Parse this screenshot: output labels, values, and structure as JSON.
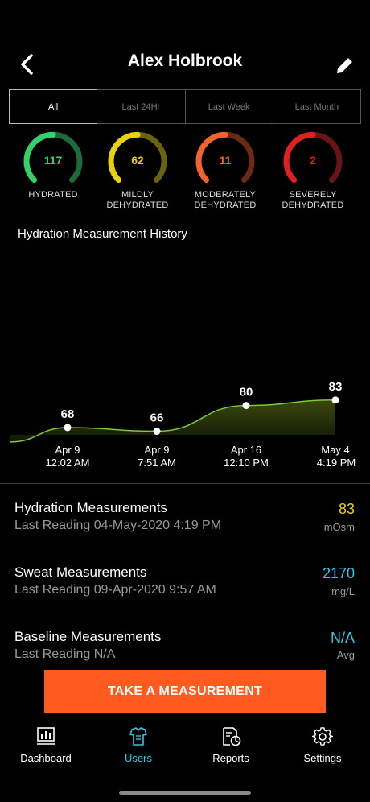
{
  "header": {
    "title": "Alex Holbrook"
  },
  "tabs": [
    {
      "label": "All",
      "active": true
    },
    {
      "label": "Last 24Hr",
      "active": false
    },
    {
      "label": "Last Week",
      "active": false
    },
    {
      "label": "Last Month",
      "active": false
    }
  ],
  "gauges": [
    {
      "value": "117",
      "label_line1": "HYDRATED",
      "label_line2": "",
      "color": "#34d16a",
      "dim": "#1d6b38"
    },
    {
      "value": "62",
      "label_line1": "MILDLY",
      "label_line2": "DEHYDRATED",
      "color": "#e8d20c",
      "dim": "#6b6210"
    },
    {
      "value": "11",
      "label_line1": "MODERATELY",
      "label_line2": "DEHYDRATED",
      "color": "#f0632a",
      "dim": "#6a2a14"
    },
    {
      "value": "2",
      "label_line1": "SEVERELY",
      "label_line2": "DEHYDRATED",
      "color": "#e02020",
      "dim": "#6a1414"
    }
  ],
  "history": {
    "title": "Hydration Measurement History"
  },
  "chart_data": {
    "type": "area",
    "title": "Hydration Measurement History",
    "x": [
      "Apr 9 12:02 AM",
      "Apr 9 7:51 AM",
      "Apr 16 12:10 PM",
      "May 4 4:19 PM"
    ],
    "x_line1": [
      "Apr 9",
      "Apr 9",
      "Apr 16",
      "May 4"
    ],
    "x_line2": [
      "12:02 AM",
      "7:51 AM",
      "12:10 PM",
      "4:19 PM"
    ],
    "values": [
      68,
      66,
      80,
      83
    ],
    "line_color": "#7dc83a",
    "grid": false
  },
  "measurements": [
    {
      "title": "Hydration Measurements",
      "sub": "Last Reading 04-May-2020 4:19 PM",
      "value": "83",
      "unit": "mOsm",
      "color": "#e8d20c"
    },
    {
      "title": "Sweat Measurements",
      "sub": "Last Reading 09-Apr-2020 9:57 AM",
      "value": "2170",
      "unit": "mg/L",
      "color": "#2fc8e8"
    },
    {
      "title": "Baseline Measurements",
      "sub": "Last Reading N/A",
      "value": "N/A",
      "unit": "Avg",
      "color": "#2fc8e8"
    }
  ],
  "cta": {
    "label": "TAKE A MEASUREMENT",
    "color": "#ff5a1f"
  },
  "nav": [
    {
      "label": "Dashboard",
      "icon": "dashboard-icon",
      "active": false
    },
    {
      "label": "Users",
      "icon": "users-icon",
      "active": true
    },
    {
      "label": "Reports",
      "icon": "reports-icon",
      "active": false
    },
    {
      "label": "Settings",
      "icon": "gear-icon",
      "active": false
    }
  ]
}
